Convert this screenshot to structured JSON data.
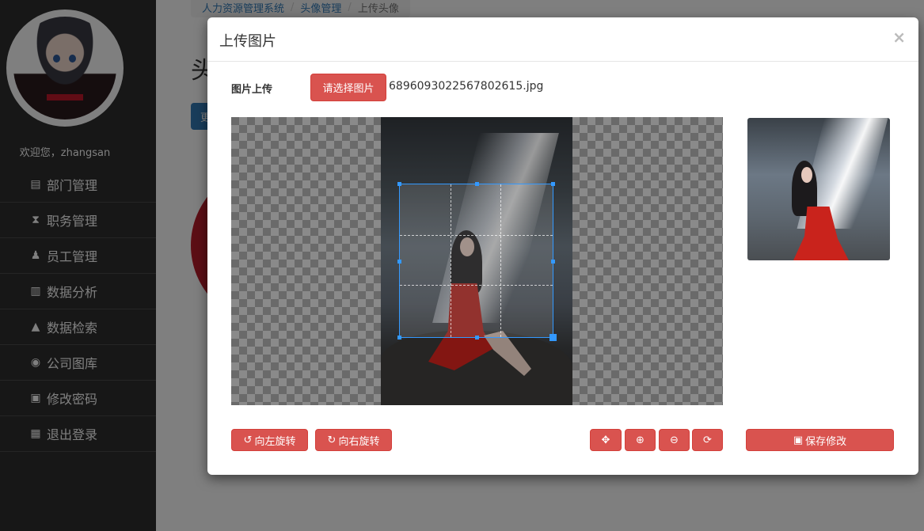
{
  "sidebar": {
    "welcome": "欢迎您，zhangsan",
    "items": [
      {
        "label": "部门管理",
        "icon": "clipboard-icon",
        "glyph": "▤"
      },
      {
        "label": "职务管理",
        "icon": "hourglass-icon",
        "glyph": "⧗"
      },
      {
        "label": "员工管理",
        "icon": "user-icon",
        "glyph": "♟"
      },
      {
        "label": "数据分析",
        "icon": "bar-chart-icon",
        "glyph": "▥"
      },
      {
        "label": "数据检索",
        "icon": "graduation-cap-icon",
        "glyph": "▲"
      },
      {
        "label": "公司图库",
        "icon": "eye-icon",
        "glyph": "◉"
      },
      {
        "label": "修改密码",
        "icon": "save-disk-icon",
        "glyph": "▣"
      },
      {
        "label": "退出登录",
        "icon": "grid-icon",
        "glyph": "▦"
      }
    ]
  },
  "background_page": {
    "breadcrumb": [
      "人力资源管理系统",
      "头像管理",
      "上传头像"
    ],
    "title_fragment": "头",
    "button_fragment": "更"
  },
  "modal": {
    "title": "上传图片",
    "close_glyph": "×",
    "upload_label": "图片上传",
    "choose_button": "请选择图片",
    "file_name": "6896093022567802615.jpg",
    "rotate_left": "向左旋转",
    "rotate_right": "向右旋转",
    "save": "保存修改",
    "glyphs": {
      "rotate_left": "↺",
      "rotate_right": "↻",
      "move": "✥",
      "zoom_in": "⊕",
      "zoom_out": "⊖",
      "reset": "⟳",
      "save": "▣"
    }
  },
  "colors": {
    "sidebar_bg": "#2f2f2f",
    "danger": "#d9534f",
    "crop_border": "#3399ff",
    "link": "#337ab7"
  }
}
